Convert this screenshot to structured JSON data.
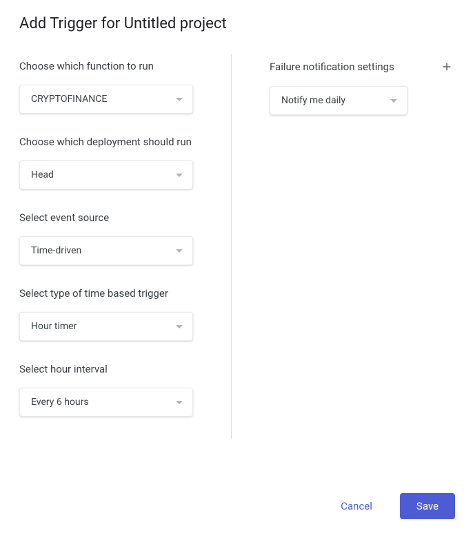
{
  "title": "Add Trigger for Untitled project",
  "left": {
    "function": {
      "label": "Choose which function to run",
      "value": "CRYPTOFINANCE"
    },
    "deployment": {
      "label": "Choose which deployment should run",
      "value": "Head"
    },
    "eventSource": {
      "label": "Select event source",
      "value": "Time-driven"
    },
    "triggerType": {
      "label": "Select type of time based trigger",
      "value": "Hour timer"
    },
    "interval": {
      "label": "Select hour interval",
      "value": "Every 6 hours"
    }
  },
  "right": {
    "notification": {
      "label": "Failure notification settings",
      "value": "Notify me daily"
    }
  },
  "footer": {
    "cancel": "Cancel",
    "save": "Save"
  }
}
